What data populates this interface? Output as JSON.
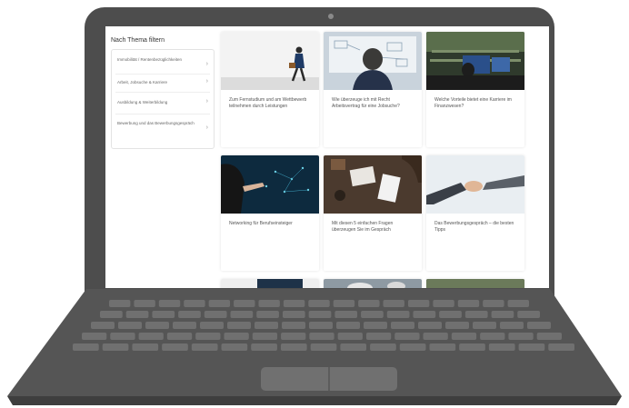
{
  "sidebar": {
    "title": "Nach Thema filtern",
    "items": [
      {
        "label": "Immobilität / Rentenbezüglichkeiten"
      },
      {
        "label": "Arbeit, Jobsuche & Karriere"
      },
      {
        "label": "Ausbildung & Weiterbildung"
      },
      {
        "label": "Bewerbung und das Bewerbungsgespräch"
      }
    ]
  },
  "cards": [
    {
      "caption": "Zum Fernstudium und am Wettbewerb teilnehmen durch Leistungen"
    },
    {
      "caption": "Wie überzeuge ich mit Recht Arbeitsvertrag für eine Jobsuche?"
    },
    {
      "caption": "Welche Vorteile bietet eine Karriere im Finanzwesen?"
    },
    {
      "caption": "Networking für Berufseinsteiger"
    },
    {
      "caption": "Mit diesen 5 einfachen Fragen überzeugen Sie im Gespräch"
    },
    {
      "caption": "Das Bewerbungsgespräch – die besten Tipps"
    },
    {
      "caption": ""
    },
    {
      "caption": ""
    },
    {
      "caption": ""
    }
  ],
  "colors": {
    "laptop_body": "#4d4d4d",
    "keys": "#6e6e6e",
    "screen_bg": "#ffffff"
  }
}
